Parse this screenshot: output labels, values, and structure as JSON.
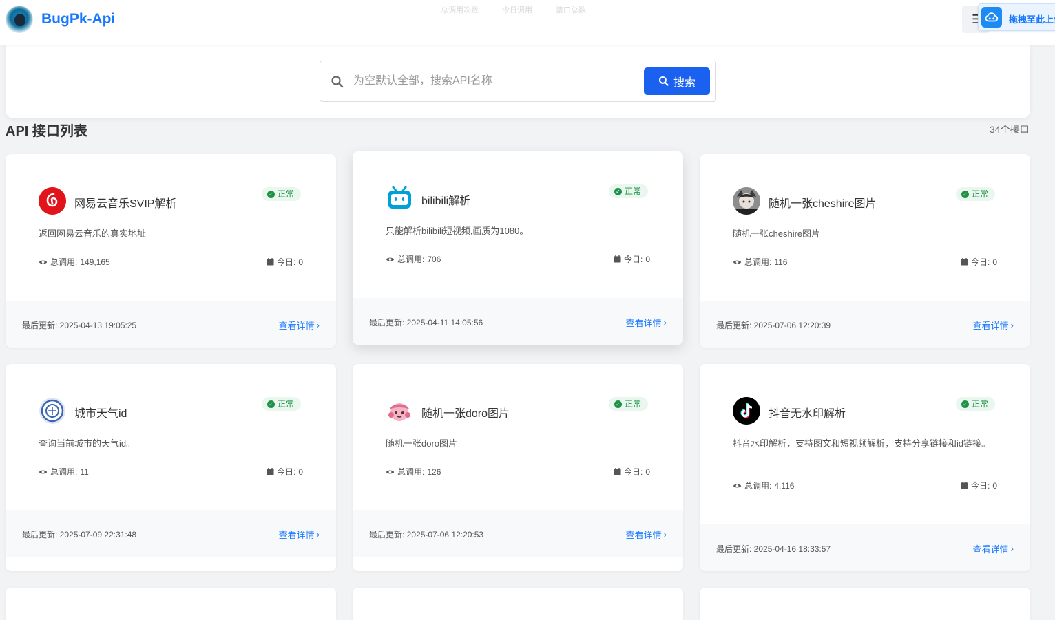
{
  "header": {
    "brand": "BugPk-Api",
    "faded_stats": [
      {
        "label": "总调用次数",
        "value": "------"
      },
      {
        "label": "今日调用",
        "value": "--"
      },
      {
        "label": "接口总数",
        "value": "--"
      }
    ],
    "menu_glyph": "☰",
    "upload_label": "拖拽至此上传"
  },
  "search": {
    "placeholder": "为空默认全部，搜索API名称",
    "value": "",
    "button_label": "搜索"
  },
  "section": {
    "title": "API 接口列表",
    "count": "34个接口"
  },
  "labels": {
    "total": "总调用: ",
    "today": "今日: ",
    "updated": "最后更新: ",
    "detail": "查看详情"
  },
  "cards": [
    {
      "icon": "netease-music-icon",
      "title": "网易云音乐SVIP解析",
      "status": "正常",
      "desc": "返回网易云音乐的真实地址",
      "total": "149,165",
      "today": "0",
      "updated": "2025-04-13 19:05:25"
    },
    {
      "icon": "bilibili-icon",
      "title": "bilibili解析",
      "status": "正常",
      "desc": "只能解析bilibili短视频,画质为1080。",
      "total": "706",
      "today": "0",
      "updated": "2025-04-11 14:05:56"
    },
    {
      "icon": "cheshire-avatar-icon",
      "title": "随机一张cheshire图片",
      "status": "正常",
      "desc": "随机一张cheshire图片",
      "total": "116",
      "today": "0",
      "updated": "2025-07-06 12:20:39"
    },
    {
      "icon": "weather-seal-icon",
      "title": "城市天气id",
      "status": "正常",
      "desc": "查询当前城市的天气id。",
      "total": "11",
      "today": "0",
      "updated": "2025-07-09 22:31:48"
    },
    {
      "icon": "doro-avatar-icon",
      "title": "随机一张doro图片",
      "status": "正常",
      "desc": "随机一张doro图片",
      "total": "126",
      "today": "0",
      "updated": "2025-07-06 12:20:53"
    },
    {
      "icon": "douyin-icon",
      "title": "抖音无水印解析",
      "status": "正常",
      "desc": "抖音水印解析，支持图文和短视频解析，支持分享链接和id链接。",
      "total": "4,116",
      "today": "0",
      "updated": "2025-04-16 18:33:57"
    }
  ],
  "colors": {
    "accent": "#1677ff",
    "button": "#1a61f0",
    "status_green": "#1f9146",
    "status_bg": "#e9f7ee"
  }
}
